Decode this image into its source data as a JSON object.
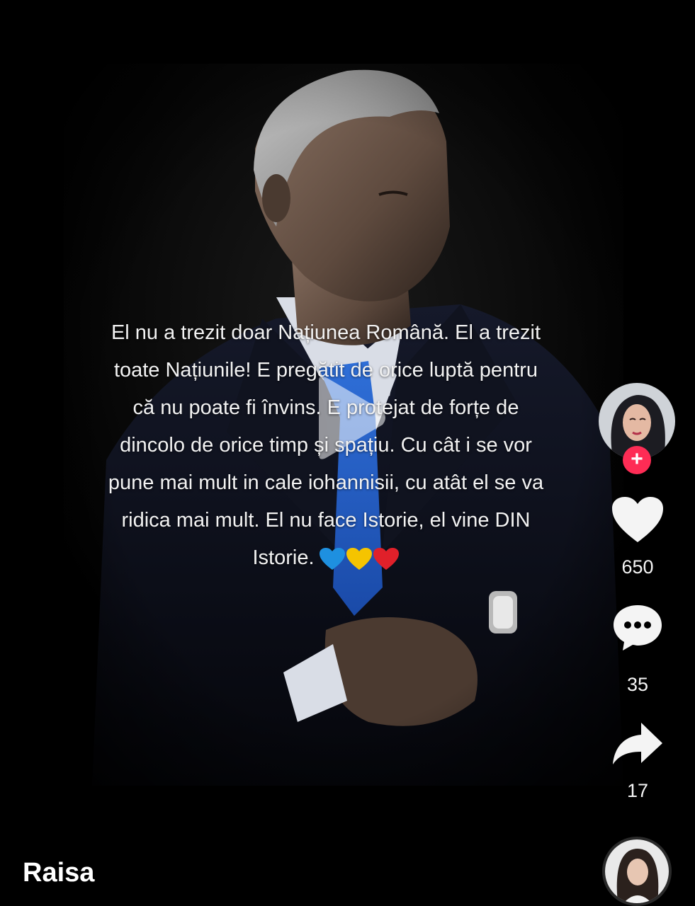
{
  "post": {
    "caption_lines": [
      "El nu a trezit doar Națiunea Română. El a trezit",
      "toate Națiunile! E pregătit de orice luptă pentru",
      "că nu poate fi învins. E protejat de forțe de",
      "dincolo de orice timp și spațiu. Cu cât i se vor",
      "pune mai mult in cale iohannisii, cu atât el se va",
      "ridica mai mult. El nu face Istorie, el vine DIN",
      "Istorie."
    ],
    "hearts": [
      "blue-heart-icon",
      "yellow-heart-icon",
      "red-heart-icon"
    ]
  },
  "creator": {
    "username": "Raisa"
  },
  "actions": {
    "likes": "650",
    "comments": "35",
    "shares": "17"
  },
  "colors": {
    "background": "#000000",
    "follow_accent": "#fe2c55",
    "heart_blue": "#1e90e0",
    "heart_yellow": "#f5c400",
    "heart_red": "#e0202a"
  },
  "icons": {
    "play": "play-icon",
    "follow": "plus-icon",
    "like": "heart-icon",
    "comment": "comment-bubble-icon",
    "share": "share-arrow-icon"
  }
}
